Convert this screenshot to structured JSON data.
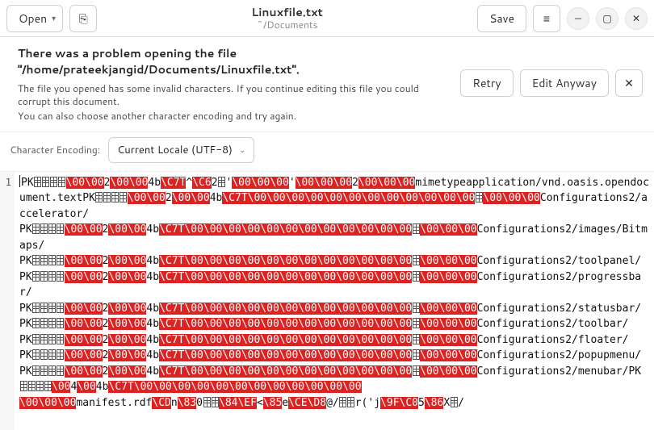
{
  "titlebar": {
    "open_label": "Open",
    "newdoc_glyph": "⎘",
    "title": "Linuxfile.txt",
    "subtitle": "~/Documents",
    "save_label": "Save",
    "hamburger_glyph": "≡",
    "min_glyph": "—",
    "max_glyph": "▢",
    "close_glyph": "✕"
  },
  "alert": {
    "heading": "There was a problem opening the file \"/home/prateekjangid/Documents/Linuxfile.txt\".",
    "line1": "The file you opened has some invalid characters. If you continue editing this file you could corrupt this document.",
    "line2": "You can also choose another character encoding and try again.",
    "retry_label": "Retry",
    "edit_anyway_label": "Edit Anyway",
    "close_glyph": "✕"
  },
  "encoding": {
    "label": "Character Encoding:",
    "value": "Current Locale (UTF-8)"
  },
  "editor": {
    "line_number": "1",
    "tokens": [
      [
        "w",
        "PK"
      ],
      [
        "b",
        4
      ],
      [
        "r",
        "\\00\\00"
      ],
      [
        "w",
        2
      ],
      [
        "r",
        "\\00\\00"
      ],
      [
        "w",
        "4b"
      ],
      [
        "r",
        "\\C7T"
      ],
      [
        "w",
        "^"
      ],
      [
        "r",
        "\\C6"
      ],
      [
        "w",
        "2"
      ],
      [
        "b",
        1
      ],
      [
        "w",
        "'"
      ],
      [
        "r",
        "\\00\\00\\00"
      ],
      [
        "w",
        "'"
      ],
      [
        "r",
        "\\00\\00\\00"
      ],
      [
        "w",
        2
      ],
      [
        "r",
        "\\00\\00\\00"
      ],
      [
        "w",
        "mimetypeapplication/vnd.oasis.opendocument.textPK"
      ],
      [
        "b",
        4
      ],
      [
        "r",
        "\\00\\00"
      ],
      [
        "w",
        2
      ],
      [
        "r",
        "\\00\\00"
      ],
      [
        "w",
        "4b"
      ],
      [
        "r",
        "\\C7T\\00\\00\\00\\00\\00\\00\\00\\00\\00\\00\\00\\00"
      ],
      [
        "b",
        1
      ],
      [
        "r",
        "\\00\\00\\00"
      ],
      [
        "w",
        "Configurations2/accelerator/\n"
      ],
      [
        "w",
        "PK"
      ],
      [
        "b",
        4
      ],
      [
        "r",
        "\\00\\00"
      ],
      [
        "w",
        2
      ],
      [
        "r",
        "\\00\\00"
      ],
      [
        "w",
        "4b"
      ],
      [
        "r",
        "\\C7T\\00\\00\\00\\00\\00\\00\\00\\00\\00\\00\\00\\00"
      ],
      [
        "b",
        1
      ],
      [
        "r",
        "\\00\\00\\00"
      ],
      [
        "w",
        "Configurations2/images/Bitmaps/\n"
      ],
      [
        "w",
        "PK"
      ],
      [
        "b",
        4
      ],
      [
        "r",
        "\\00\\00"
      ],
      [
        "w",
        2
      ],
      [
        "r",
        "\\00\\00"
      ],
      [
        "w",
        "4b"
      ],
      [
        "r",
        "\\C7T\\00\\00\\00\\00\\00\\00\\00\\00\\00\\00\\00\\00"
      ],
      [
        "b",
        1
      ],
      [
        "r",
        "\\00\\00\\00"
      ],
      [
        "w",
        "Configurations2/toolpanel/\n"
      ],
      [
        "w",
        "PK"
      ],
      [
        "b",
        4
      ],
      [
        "r",
        "\\00\\00"
      ],
      [
        "w",
        2
      ],
      [
        "r",
        "\\00\\00"
      ],
      [
        "w",
        "4b"
      ],
      [
        "r",
        "\\C7T\\00\\00\\00\\00\\00\\00\\00\\00\\00\\00\\00\\00"
      ],
      [
        "b",
        1
      ],
      [
        "r",
        "\\00\\00\\00"
      ],
      [
        "w",
        "Configurations2/progressbar/\n"
      ],
      [
        "w",
        "PK"
      ],
      [
        "b",
        4
      ],
      [
        "r",
        "\\00\\00"
      ],
      [
        "w",
        2
      ],
      [
        "r",
        "\\00\\00"
      ],
      [
        "w",
        "4b"
      ],
      [
        "r",
        "\\C7T\\00\\00\\00\\00\\00\\00\\00\\00\\00\\00\\00\\00"
      ],
      [
        "b",
        1
      ],
      [
        "r",
        "\\00\\00\\00"
      ],
      [
        "w",
        "Configurations2/statusbar/\n"
      ],
      [
        "w",
        "PK"
      ],
      [
        "b",
        4
      ],
      [
        "r",
        "\\00\\00"
      ],
      [
        "w",
        2
      ],
      [
        "r",
        "\\00\\00"
      ],
      [
        "w",
        "4b"
      ],
      [
        "r",
        "\\C7T\\00\\00\\00\\00\\00\\00\\00\\00\\00\\00\\00\\00"
      ],
      [
        "b",
        1
      ],
      [
        "r",
        "\\00\\00\\00"
      ],
      [
        "w",
        "Configurations2/toolbar/\n"
      ],
      [
        "w",
        "PK"
      ],
      [
        "b",
        4
      ],
      [
        "r",
        "\\00\\00"
      ],
      [
        "w",
        2
      ],
      [
        "r",
        "\\00\\00"
      ],
      [
        "w",
        "4b"
      ],
      [
        "r",
        "\\C7T\\00\\00\\00\\00\\00\\00\\00\\00\\00\\00\\00\\00"
      ],
      [
        "b",
        1
      ],
      [
        "r",
        "\\00\\00\\00"
      ],
      [
        "w",
        "Configurations2/floater/\n"
      ],
      [
        "w",
        "PK"
      ],
      [
        "b",
        4
      ],
      [
        "r",
        "\\00\\00"
      ],
      [
        "w",
        2
      ],
      [
        "r",
        "\\00\\00"
      ],
      [
        "w",
        "4b"
      ],
      [
        "r",
        "\\C7T\\00\\00\\00\\00\\00\\00\\00\\00\\00\\00\\00\\00"
      ],
      [
        "b",
        1
      ],
      [
        "r",
        "\\00\\00\\00"
      ],
      [
        "w",
        "Configurations2/popupmenu/\n"
      ],
      [
        "w",
        "PK"
      ],
      [
        "b",
        4
      ],
      [
        "r",
        "\\00\\00"
      ],
      [
        "w",
        2
      ],
      [
        "r",
        "\\00\\00"
      ],
      [
        "w",
        "4b"
      ],
      [
        "r",
        "\\C7T\\00\\00\\00\\00\\00\\00\\00\\00\\00\\00\\00\\00"
      ],
      [
        "b",
        1
      ],
      [
        "r",
        "\\00\\00\\00"
      ],
      [
        "w",
        "Configurations2/menubar/PK"
      ],
      [
        "b",
        4
      ],
      [
        "r",
        "\\00"
      ],
      [
        "w",
        4
      ],
      [
        "r",
        "\\00"
      ],
      [
        "w",
        "4b"
      ],
      [
        "r",
        "\\C7T\\00\\00\\00\\00\\00\\00\\00\\00\\00\\00\\00\\00"
      ],
      [
        "w",
        "\n"
      ],
      [
        "r",
        "\\00\\00\\00"
      ],
      [
        "w",
        "manifest.rdf"
      ],
      [
        "r",
        "\\CD"
      ],
      [
        "w",
        "n"
      ],
      [
        "r",
        "\\83"
      ],
      [
        "w",
        "0"
      ],
      [
        "b",
        2
      ],
      [
        "r",
        "\\84\\EF"
      ],
      [
        "w",
        "<"
      ],
      [
        "r",
        "\\85"
      ],
      [
        "w",
        "e"
      ],
      [
        "r",
        "\\CE\\D8"
      ],
      [
        "w",
        "@/"
      ],
      [
        "b",
        2
      ],
      [
        "w",
        "r('j"
      ],
      [
        "r",
        "\\9F\\C0"
      ],
      [
        "w",
        "5"
      ],
      [
        "r",
        "\\86"
      ],
      [
        "w",
        "X"
      ],
      [
        "b",
        1
      ],
      [
        "w",
        "/"
      ]
    ]
  }
}
